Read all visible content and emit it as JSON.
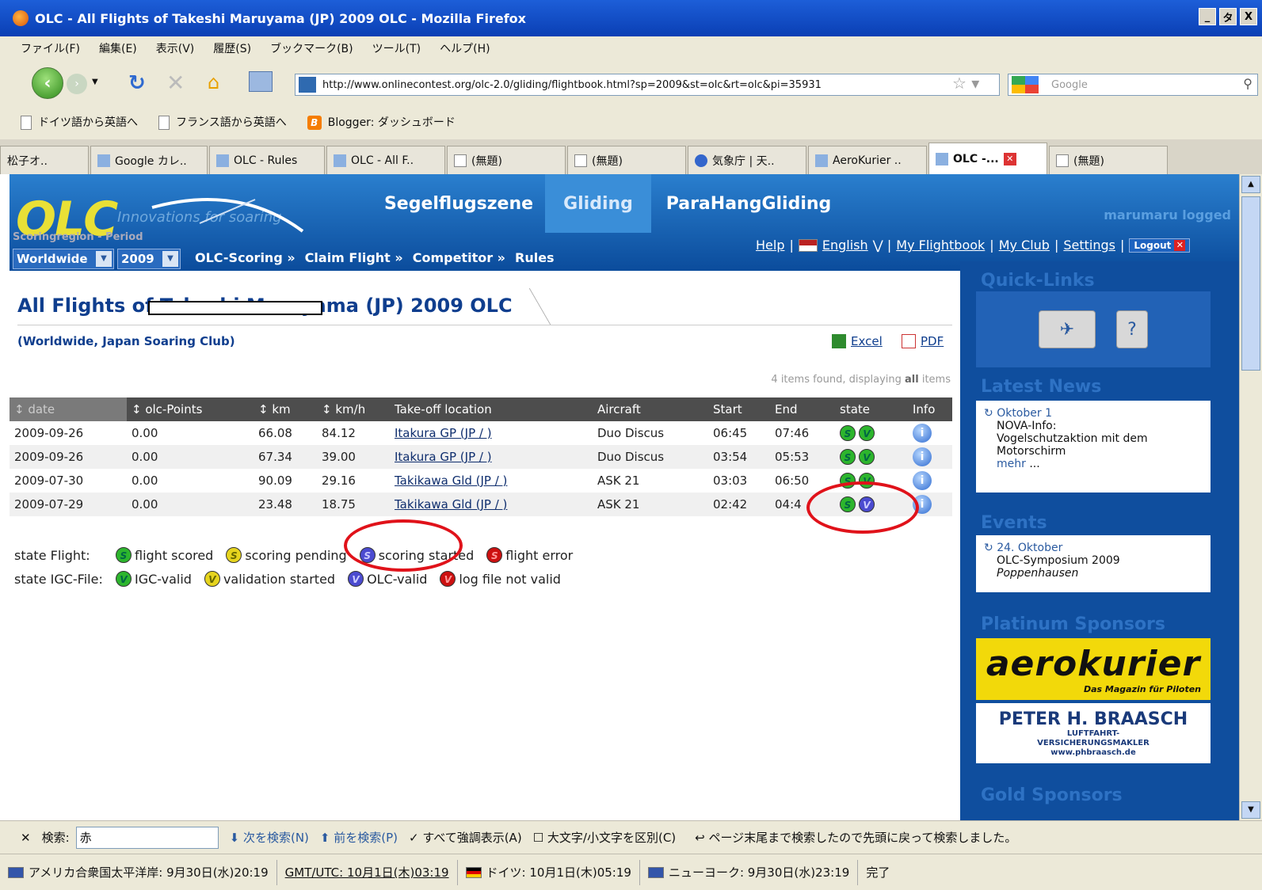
{
  "window": {
    "title": "OLC - All Flights of Takeshi Maruyama (JP) 2009 OLC - Mozilla Firefox",
    "controls": [
      "_",
      "タ",
      "X"
    ]
  },
  "menu": [
    "ファイル(F)",
    "編集(E)",
    "表示(V)",
    "履歴(S)",
    "ブックマーク(B)",
    "ツール(T)",
    "ヘルプ(H)"
  ],
  "nav": {
    "url": "http://www.onlinecontest.org/olc-2.0/gliding/flightbook.html?sp=2009&st=olc&rt=olc&pi=35931",
    "search_placeholder": "Google"
  },
  "bookmarks": [
    "ドイツ語から英語へ",
    "フランス語から英語へ",
    "Blogger: ダッシュボード"
  ],
  "tabs": [
    {
      "label": "松子オ.."
    },
    {
      "label": "Google カレ.."
    },
    {
      "label": "OLC - Rules"
    },
    {
      "label": "OLC - All F.."
    },
    {
      "label": "(無題)"
    },
    {
      "label": "(無題)"
    },
    {
      "label": "気象庁 | 天.."
    },
    {
      "label": "AeroKurier .."
    },
    {
      "label": "OLC -..."
    },
    {
      "label": "(無題)"
    }
  ],
  "olc": {
    "logo": "OLC",
    "tagline": "Innovations for soaring",
    "region_label": "Scoringregion - Period",
    "region": "Worldwide",
    "period": "2009",
    "topnav": [
      "Segelflugszene",
      "Gliding",
      "ParaHangGliding"
    ],
    "submenu": [
      "OLC-Scoring »",
      "Claim Flight »",
      "Competitor »",
      "Rules"
    ],
    "username": "marumaru logged",
    "toplinks": {
      "help": "Help",
      "lang": "English",
      "flightbook": "My Flightbook",
      "club": "My Club",
      "settings": "Settings",
      "logout": "Logout"
    }
  },
  "page": {
    "title": "All Flights of Takeshi Maruyama (JP) 2009 OLC",
    "subtitle": "(Worldwide, Japan Soaring Club)",
    "excel": "Excel",
    "pdf": "PDF",
    "count_prefix": "4 items found, displaying ",
    "count_all": "all",
    "count_suffix": " items"
  },
  "table": {
    "headers": [
      "↕ date",
      "↕ olc-Points",
      "↕ km",
      "↕ km/h",
      "Take-off location",
      "Aircraft",
      "Start",
      "End",
      "state",
      "Info"
    ],
    "rows": [
      {
        "date": "2009-09-26",
        "points": "0.00",
        "km": "66.08",
        "kmh": "84.12",
        "location": "Itakura GP (JP / )",
        "aircraft": "Duo Discus",
        "start": "06:45",
        "end": "07:46",
        "s": "g",
        "v": "g"
      },
      {
        "date": "2009-09-26",
        "points": "0.00",
        "km": "67.34",
        "kmh": "39.00",
        "location": "Itakura GP (JP / )",
        "aircraft": "Duo Discus",
        "start": "03:54",
        "end": "05:53",
        "s": "g",
        "v": "g"
      },
      {
        "date": "2009-07-30",
        "points": "0.00",
        "km": "90.09",
        "kmh": "29.16",
        "location": "Takikawa Gld (JP / )",
        "aircraft": "ASK 21",
        "start": "03:03",
        "end": "06:50",
        "s": "g",
        "v": "g"
      },
      {
        "date": "2009-07-29",
        "points": "0.00",
        "km": "23.48",
        "kmh": "18.75",
        "location": "Takikawa Gld (JP / )",
        "aircraft": "ASK 21",
        "start": "02:42",
        "end": "04:4",
        "s": "g",
        "v": "b"
      }
    ]
  },
  "legend": {
    "flight_label": "state Flight:",
    "igc_label": "state IGC-File:",
    "flight": [
      "flight scored",
      "scoring pending",
      "scoring started",
      "flight error"
    ],
    "igc": [
      "IGC-valid",
      "validation started",
      "OLC-valid",
      "log file not valid"
    ]
  },
  "sidebar": {
    "quicklinks_title": "Quick-Links",
    "news_title": "Latest News",
    "news_date": "Oktober 1",
    "news_line1": "NOVA-Info:",
    "news_line2": "Vogelschutzaktion mit dem Motorschirm",
    "news_more": "mehr",
    "events_title": "Events",
    "event_date": "24. Oktober",
    "event_name": "OLC-Symposium 2009",
    "event_place": "Poppenhausen",
    "platinum_title": "Platinum Sponsors",
    "sponsor1": "aerokurier",
    "sponsor1_sub": "Das Magazin für Piloten",
    "sponsor2": "PETER H. BRAASCH",
    "sponsor2_sub1": "LUFTFAHRT-",
    "sponsor2_sub2": "VERSICHERUNGSMAKLER",
    "sponsor2_url": "www.phbraasch.de",
    "gold_title": "Gold Sponsors"
  },
  "findbar": {
    "label": "検索:",
    "value": "赤",
    "next": "次を検索(N)",
    "prev": "前を検索(P)",
    "highlight": "すべて強調表示(A)",
    "match_case": "大文字/小文字を区別(C)",
    "wrapped": "ページ末尾まで検索したので先頭に戻って検索しました。"
  },
  "status": {
    "clock1": "アメリカ合衆国太平洋岸: 9月30日(水)20:19",
    "clock2": "GMT/UTC: 10月1日(木)03:19",
    "clock3": "ドイツ: 10月1日(木)05:19",
    "clock4": "ニューヨーク: 9月30日(水)23:19",
    "done": "完了"
  },
  "colors": {
    "olc_blue": "#0b4c9c",
    "logo_yellow": "#e9e036",
    "circle_red": "#e0121a",
    "state_green": "#2db52d",
    "state_blue": "#4b4bd0"
  }
}
